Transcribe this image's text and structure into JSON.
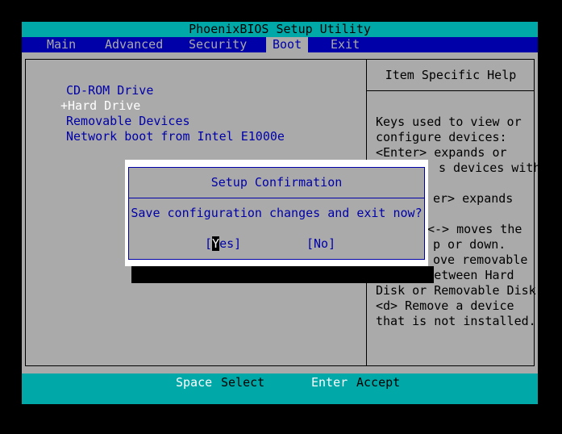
{
  "title": "PhoenixBIOS Setup Utility",
  "menu": {
    "items": [
      {
        "label": "Main"
      },
      {
        "label": "Advanced"
      },
      {
        "label": "Security"
      },
      {
        "label": "Boot"
      },
      {
        "label": "Exit"
      }
    ],
    "selected": "Boot"
  },
  "boot_list": {
    "items": [
      {
        "label": "CD-ROM Drive"
      },
      {
        "label": "+Hard Drive"
      },
      {
        "label": "Removable Devices"
      },
      {
        "label": "Network boot from Intel E1000e"
      }
    ]
  },
  "help": {
    "title": "Item Specific Help",
    "lines_visible": [
      "Keys used to view or",
      "configure devices:",
      "<Enter> expands or",
      "s devices with",
      "er> expands",
      "<-> moves the",
      "p or down.",
      "ove removable",
      "device between Hard",
      "Disk or Removable Disk",
      "<d> Remove a device",
      "that is not installed."
    ]
  },
  "dialog": {
    "title": "Setup Confirmation",
    "message": "Save configuration changes and exit now?",
    "yes_open": "[",
    "yes_first": "Y",
    "yes_rest": "es]",
    "no_label": "[No]"
  },
  "status": {
    "key1": "Space",
    "action1": "Select",
    "key2": "Enter",
    "action2": "Accept"
  },
  "colors": {
    "cyan": "#00a8a8",
    "blue": "#0000a8",
    "gray": "#aaaaaa",
    "white": "#ffffff",
    "black": "#000000"
  }
}
